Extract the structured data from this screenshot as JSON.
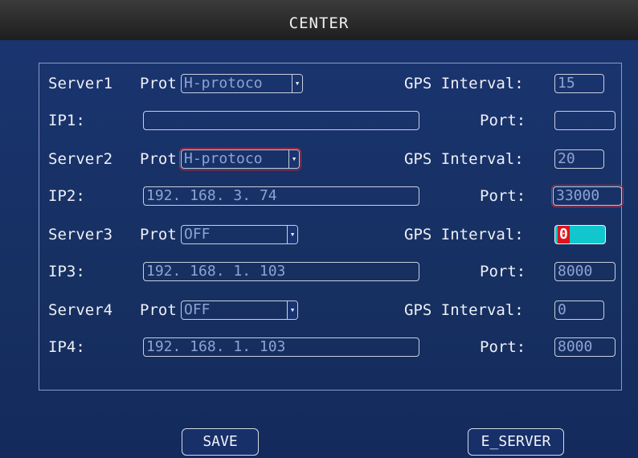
{
  "window": {
    "title": "CENTER"
  },
  "servers": [
    {
      "label": "Server1",
      "prot_label": "Prot",
      "protocol": "H-protoco",
      "gps_label": "GPS Interval:",
      "gps_interval": "15",
      "ip_label": "IP1:",
      "ip": "",
      "port_label": "Port:",
      "port": ""
    },
    {
      "label": "Server2",
      "prot_label": "Prot",
      "protocol": "H-protoco",
      "gps_label": "GPS Interval:",
      "gps_interval": "20",
      "ip_label": "IP2:",
      "ip": "192. 168. 3. 74",
      "port_label": "Port:",
      "port": "33000"
    },
    {
      "label": "Server3",
      "prot_label": "Prot",
      "protocol": "OFF",
      "gps_label": "GPS Interval:",
      "gps_interval": "0",
      "ip_label": "IP3:",
      "ip": "192. 168. 1. 103",
      "port_label": "Port:",
      "port": "8000"
    },
    {
      "label": "Server4",
      "prot_label": "Prot",
      "protocol": "OFF",
      "gps_label": "GPS Interval:",
      "gps_interval": "0",
      "ip_label": "IP4:",
      "ip": "192. 168. 1. 103",
      "port_label": "Port:",
      "port": "8000"
    }
  ],
  "buttons": {
    "save": "SAVE",
    "e_server": "E_SERVER"
  },
  "colors": {
    "background": "#142a5c",
    "focus": "#11c7cd",
    "highlight_outline": "#d2262a",
    "cursor": "#e0141a"
  }
}
